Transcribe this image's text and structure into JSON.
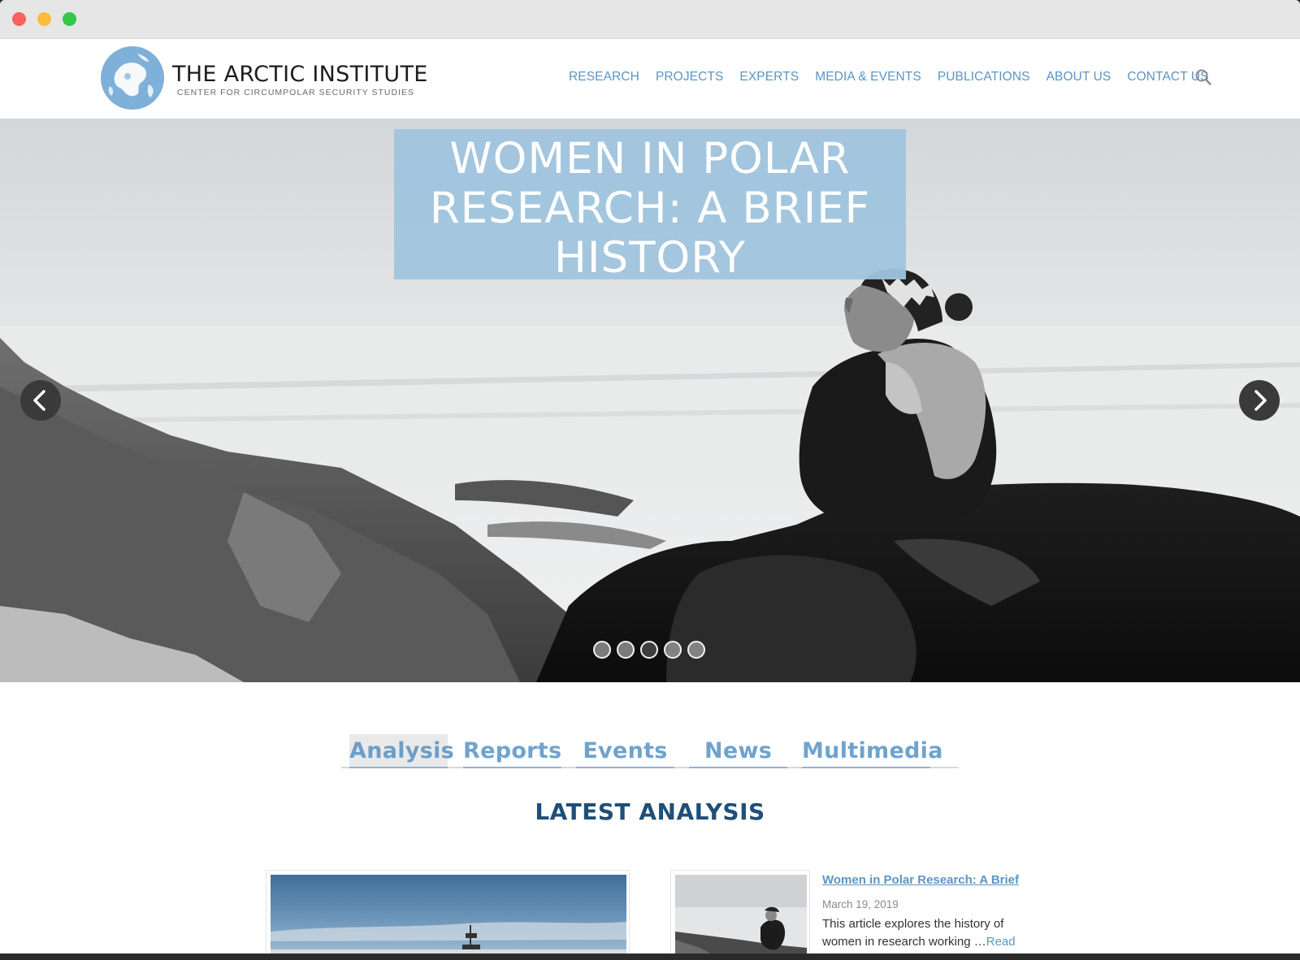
{
  "window": {
    "controls": [
      "close",
      "minimize",
      "maximize"
    ]
  },
  "header": {
    "logo_title": "THE ARCTIC INSTITUTE",
    "logo_subtitle": "CENTER FOR CIRCUMPOLAR SECURITY STUDIES",
    "nav": [
      "RESEARCH",
      "PROJECTS",
      "EXPERTS",
      "MEDIA & EVENTS",
      "PUBLICATIONS",
      "ABOUT US",
      "CONTACT US"
    ],
    "search_icon": "search-icon"
  },
  "hero": {
    "caption": "WOMEN IN POLAR RESEARCH: A BRIEF HISTORY",
    "slide_count": 5,
    "active_slide": 3,
    "prev_icon": "chevron-left-icon",
    "next_icon": "chevron-right-icon"
  },
  "tabs": {
    "items": [
      "Analysis",
      "Reports",
      "Events",
      "News",
      "Multimedia"
    ],
    "active": "Analysis"
  },
  "section": {
    "title": "LATEST ANALYSIS"
  },
  "articles": [
    {
      "title": "Women in Polar Research: A Brief",
      "date": "March 19, 2019",
      "excerpt": "This article explores the history of women in research working …",
      "read_more": "Read"
    }
  ],
  "colors": {
    "nav_link": "#5b95c4",
    "caption_bg": "#a0c4de",
    "section_title": "#1f4f79",
    "tab_text": "#6fa3cd"
  }
}
